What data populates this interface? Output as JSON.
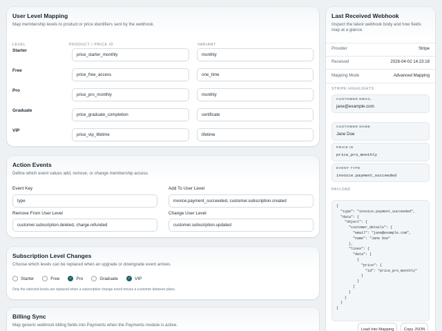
{
  "mapping": {
    "title": "User Level Mapping",
    "subtitle": "Map membership levels to product or price identifiers sent by the webhook.",
    "col_level": "LEVEL",
    "col_product": "PRODUCT / PRICE ID",
    "col_variant": "VARIANT",
    "rows": [
      {
        "level": "Starter",
        "product": "price_starter_monthly",
        "variant": "monthly"
      },
      {
        "level": "Free",
        "product": "price_free_access",
        "variant": "one_time"
      },
      {
        "level": "Pro",
        "product": "price_pro_monthly",
        "variant": "monthly"
      },
      {
        "level": "Graduate",
        "product": "price_graduate_completion",
        "variant": "certificate"
      },
      {
        "level": "VIP",
        "product": "price_vip_lifetime",
        "variant": "lifetime"
      }
    ]
  },
  "actions": {
    "title": "Action Events",
    "subtitle": "Define which event values add, remove, or change membership access.",
    "event_key_label": "Event Key",
    "event_key_value": "type",
    "add_label": "Add To User Level",
    "add_value": "invoice.payment_succeeded, customer.subscription.created",
    "remove_label": "Remove From User Level",
    "remove_value": "customer.subscription.deleted, charge.refunded",
    "change_label": "Change User Level",
    "change_value": "customer.subscription.updated"
  },
  "subs": {
    "title": "Subscription Level Changes",
    "subtitle": "Choose which levels can be replaced when an upgrade or downgrade event arrives.",
    "levels": [
      {
        "label": "Starter",
        "checked": false
      },
      {
        "label": "Free",
        "checked": false
      },
      {
        "label": "Pro",
        "checked": true
      },
      {
        "label": "Graduate",
        "checked": false
      },
      {
        "label": "VIP",
        "checked": true
      }
    ],
    "note": "Only the selected levels are replaced when a subscription change event moves a customer between plans."
  },
  "billing": {
    "title": "Billing Sync",
    "subtitle": "Map generic webhook billing fields into Payments when the Payments module is active."
  },
  "panel": {
    "title": "Last Received Webhook",
    "subtitle": "Inspect the latest webhook body and how fields map at a glance.",
    "provider_label": "Provider",
    "provider_value": "Stripe",
    "received_label": "Received",
    "received_value": "2026-04-02 14:23:18",
    "mode_label": "Mapping Mode",
    "mode_value": "Advanced Mapping",
    "highlights_label": "STRIPE HIGHLIGHTS",
    "highlights": [
      {
        "key": "CUSTOMER EMAIL",
        "value": "jane@example.com",
        "mono": false
      },
      {
        "key": "CUSTOMER NAME",
        "value": "Jane Doe",
        "mono": false
      },
      {
        "key": "PRICE ID",
        "value": "price_pro_monthly",
        "mono": true
      },
      {
        "key": "EVENT TYPE",
        "value": "invoice.payment_succeeded",
        "mono": true
      }
    ],
    "payload_label": "PAYLOAD",
    "payload": "{\n  \"type\": \"invoice.payment_succeeded\",\n  \"data\": {\n    \"object\": {\n      \"customer_details\": {\n        \"email\": \"jane@example.com\",\n        \"name\": \"Jane Doe\"\n      },\n      \"lines\": {\n        \"data\": [\n          {\n            \"price\": {\n              \"id\": \"price_pro_monthly\"\n            }\n          }\n        ]\n      }\n    }\n  }\n}",
    "load_button": "Load Into Mapping",
    "copy_button": "Copy JSON"
  }
}
